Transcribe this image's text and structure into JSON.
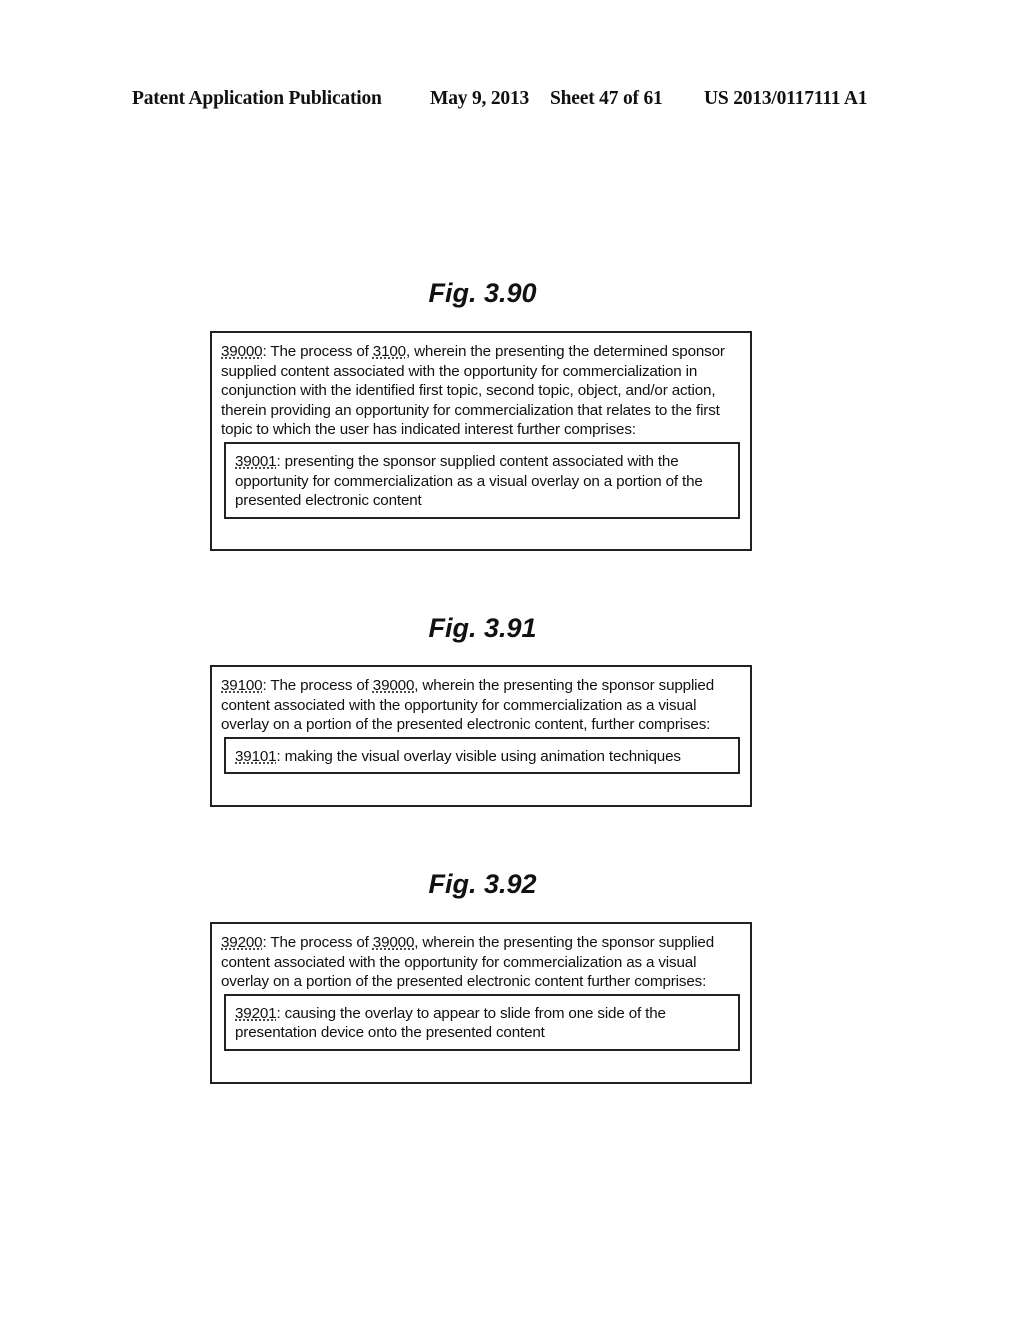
{
  "header": {
    "publication": "Patent Application Publication",
    "date": "May 9, 2013",
    "sheet": "Sheet 47 of 61",
    "number": "US 2013/0117111 A1"
  },
  "figures": [
    {
      "title": "Fig. 3.90",
      "outer": {
        "id": "39000",
        "sep": ": The process of ",
        "ref": "3100",
        "text": ", wherein the presenting the determined sponsor supplied content associated with the opportunity for commercialization in conjunction with the identified first topic, second topic, object, and/or action, therein providing an opportunity for commercialization that relates to the first topic to which the user has indicated interest further comprises:"
      },
      "inner": {
        "id": "39001",
        "text": ": presenting the sponsor supplied content associated with the opportunity for commercialization as a visual overlay on a portion of the presented electronic content"
      }
    },
    {
      "title": "Fig. 3.91",
      "outer": {
        "id": "39100",
        "sep": ": The process of ",
        "ref": "39000",
        "text": ", wherein the presenting the sponsor supplied content associated with the opportunity for commercialization as a visual overlay on a portion of the presented electronic content, further comprises:"
      },
      "inner": {
        "id": "39101",
        "text": ": making the visual overlay visible using animation techniques"
      }
    },
    {
      "title": "Fig. 3.92",
      "outer": {
        "id": "39200",
        "sep": ": The process of ",
        "ref": "39000",
        "text": ", wherein the presenting the sponsor supplied content associated with the opportunity for commercialization as a visual overlay on a portion of the presented electronic content further comprises:"
      },
      "inner": {
        "id": "39201",
        "text": ": causing the overlay to appear to slide from one side of the presentation device onto the presented content"
      }
    }
  ]
}
